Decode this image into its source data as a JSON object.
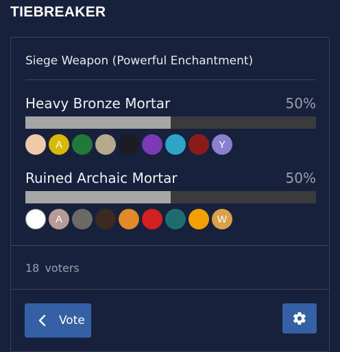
{
  "heading": "TIEBREAKER",
  "poll": {
    "title": "Siege Weapon (Powerful Enchantment)",
    "options": [
      {
        "name": "Heavy Bronze Mortar",
        "percent_label": "50%",
        "percent": 50,
        "voters": [
          {
            "letter": "",
            "color": "#f2c9a8",
            "icon": "eye-avatar"
          },
          {
            "letter": "A",
            "color": "#d9b800",
            "icon": "letter-avatar"
          },
          {
            "letter": "",
            "color": "#1f7a3a",
            "icon": "card-avatar"
          },
          {
            "letter": "",
            "color": "#b7aa8c",
            "icon": "landscape-avatar"
          },
          {
            "letter": "",
            "color": "#1c1c24",
            "icon": "dark-scene-avatar"
          },
          {
            "letter": "",
            "color": "#7a3ab5",
            "icon": "purple-avatar"
          },
          {
            "letter": "",
            "color": "#2fa4c9",
            "icon": "cyan-avatar"
          },
          {
            "letter": "",
            "color": "#8b1a1a",
            "icon": "red-figure-avatar"
          },
          {
            "letter": "Y",
            "color": "#8a80d0",
            "icon": "y-logo-avatar"
          }
        ]
      },
      {
        "name": "Ruined Archaic Mortar",
        "percent_label": "50%",
        "percent": 50,
        "voters": [
          {
            "letter": "",
            "color": "#ffffff",
            "icon": "meme-face-avatar"
          },
          {
            "letter": "A",
            "color": "#b59a96",
            "icon": "letter-avatar"
          },
          {
            "letter": "",
            "color": "#6d6a66",
            "icon": "grey-figure-avatar"
          },
          {
            "letter": "",
            "color": "#3a2a22",
            "icon": "anime-face-avatar"
          },
          {
            "letter": "",
            "color": "#e08a2a",
            "icon": "orange-food-avatar"
          },
          {
            "letter": "",
            "color": "#d32020",
            "icon": "red-hat-avatar"
          },
          {
            "letter": "",
            "color": "#1e6d6e",
            "icon": "teal-creature-avatar"
          },
          {
            "letter": "",
            "color": "#f2a000",
            "icon": "fire-avatar"
          },
          {
            "letter": "W",
            "color": "#d9a24a",
            "icon": "letter-avatar"
          }
        ]
      }
    ],
    "voters_label": "18  voters",
    "vote_button": "Vote"
  },
  "colors": {
    "background": "#17213b",
    "button": "#3660a6",
    "bar_track": "#3b3b3e",
    "bar_fill": "#a6a6a6"
  }
}
